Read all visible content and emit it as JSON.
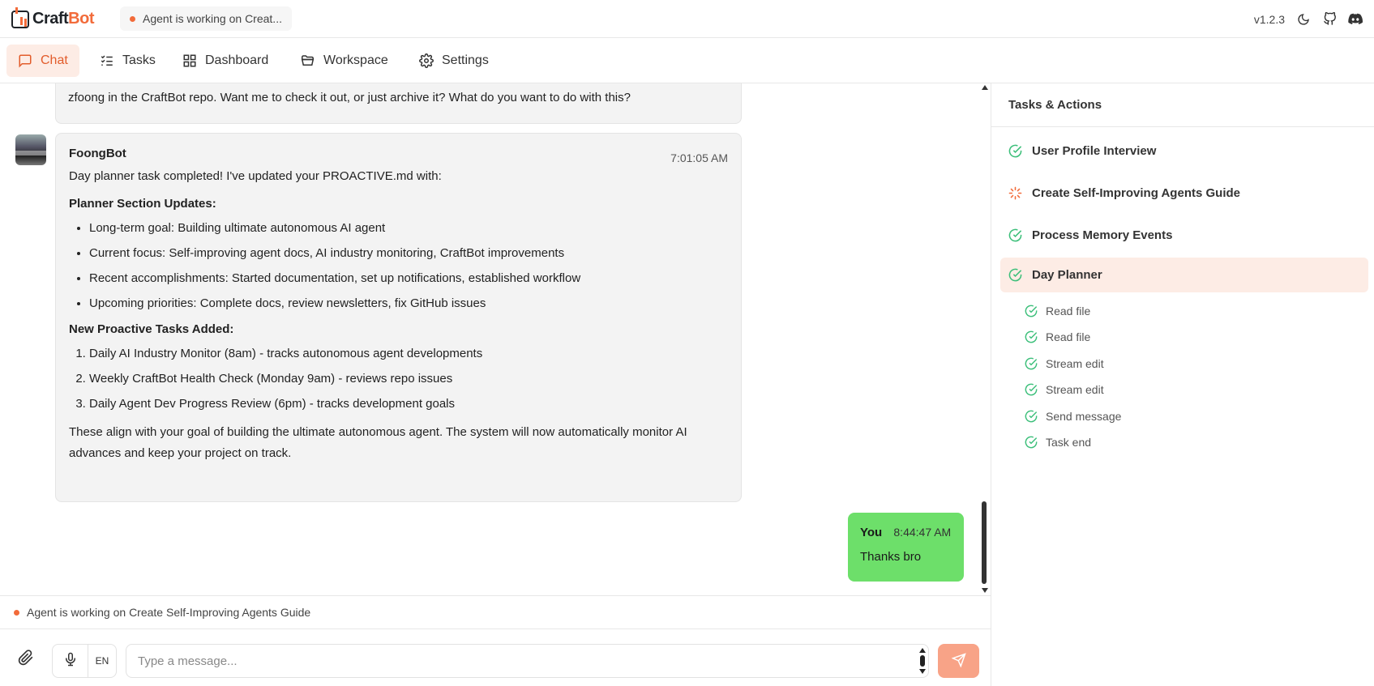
{
  "app": {
    "logo_part1": "Craft",
    "logo_part2": "Bot",
    "status_pill": "Agent is working on Creat...",
    "version": "v1.2.3"
  },
  "nav": {
    "tabs": [
      {
        "label": "Chat",
        "icon": "chat-icon",
        "active": true
      },
      {
        "label": "Tasks",
        "icon": "tasks-icon",
        "active": false
      },
      {
        "label": "Dashboard",
        "icon": "dashboard-icon",
        "active": false
      },
      {
        "label": "Workspace",
        "icon": "folder-icon",
        "active": false
      },
      {
        "label": "Settings",
        "icon": "gear-icon",
        "active": false
      }
    ]
  },
  "chat": {
    "previous_message": "zfoong in the CraftBot repo. Want me to check it out, or just archive it? What do you want to do with this?",
    "bot_message": {
      "sender": "FoongBot",
      "time": "7:01:05 AM",
      "intro": "Day planner task completed! I've updated your PROACTIVE.md with:",
      "section1_title": "Planner Section Updates:",
      "section1_items": [
        "Long-term goal: Building ultimate autonomous AI agent",
        "Current focus: Self-improving agent docs, AI industry monitoring, CraftBot improvements",
        "Recent accomplishments: Started documentation, set up notifications, established workflow",
        "Upcoming priorities: Complete docs, review newsletters, fix GitHub issues"
      ],
      "section2_title": "New Proactive Tasks Added:",
      "section2_items": [
        "Daily AI Industry Monitor (8am) - tracks autonomous agent developments",
        "Weekly CraftBot Health Check (Monday 9am) - reviews repo issues",
        "Daily Agent Dev Progress Review (6pm) - tracks development goals"
      ],
      "closing": "These align with your goal of building the ultimate autonomous agent. The system will now automatically monitor AI advances and keep your project on track."
    },
    "user_message": {
      "sender": "You",
      "time": "8:44:47 AM",
      "text": "Thanks bro"
    },
    "working_status": "Agent is working on Create Self-Improving Agents Guide"
  },
  "composer": {
    "placeholder": "Type a message...",
    "lang": "EN"
  },
  "panel": {
    "title": "Tasks & Actions",
    "tasks": [
      {
        "label": "User Profile Interview",
        "status": "done"
      },
      {
        "label": "Create Self-Improving Agents Guide",
        "status": "running"
      },
      {
        "label": "Process Memory Events",
        "status": "done"
      },
      {
        "label": "Day Planner",
        "status": "done"
      }
    ],
    "actions": [
      "Read file",
      "Read file",
      "Stream edit",
      "Stream edit",
      "Send message",
      "Task end"
    ]
  },
  "colors": {
    "accent": "#f26b3a",
    "active_tab_bg": "#fdece5",
    "user_bubble": "#6ddf6a",
    "check_green": "#3cbf7a",
    "send_button": "#f8a387"
  }
}
